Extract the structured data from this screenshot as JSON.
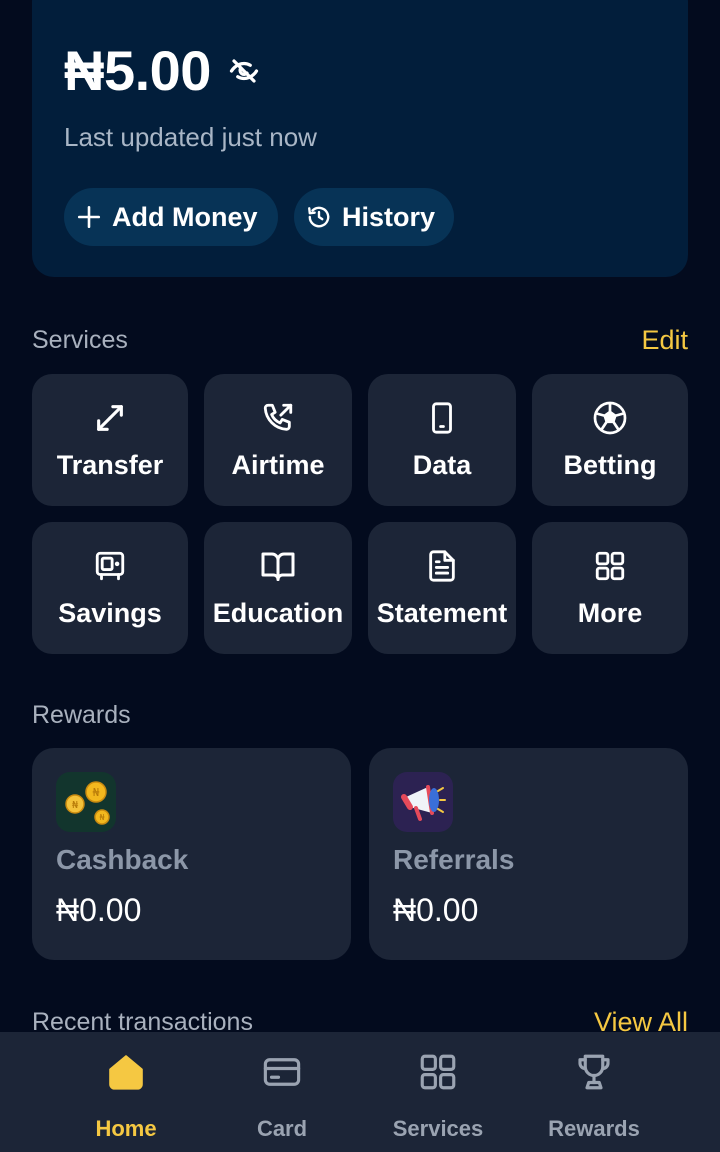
{
  "balance": {
    "amount": "₦5.00",
    "last_updated": "Last updated just now",
    "add_money_label": "Add Money",
    "history_label": "History"
  },
  "services": {
    "title": "Services",
    "edit_label": "Edit",
    "items": [
      {
        "label": "Transfer",
        "icon": "transfer-icon"
      },
      {
        "label": "Airtime",
        "icon": "phone-call-icon"
      },
      {
        "label": "Data",
        "icon": "smartphone-icon"
      },
      {
        "label": "Betting",
        "icon": "soccer-ball-icon"
      },
      {
        "label": "Savings",
        "icon": "safe-icon"
      },
      {
        "label": "Education",
        "icon": "book-icon"
      },
      {
        "label": "Statement",
        "icon": "document-icon"
      },
      {
        "label": "More",
        "icon": "grid-icon"
      }
    ]
  },
  "rewards": {
    "title": "Rewards",
    "cashback": {
      "label": "Cashback",
      "value": "₦0.00",
      "icon": "coins-icon"
    },
    "referrals": {
      "label": "Referrals",
      "value": "₦0.00",
      "icon": "megaphone-icon"
    }
  },
  "recent": {
    "title": "Recent transactions",
    "view_all_label": "View All"
  },
  "nav": {
    "items": [
      {
        "label": "Home",
        "icon": "home-icon",
        "active": true
      },
      {
        "label": "Card",
        "icon": "card-icon",
        "active": false
      },
      {
        "label": "Services",
        "icon": "grid-icon",
        "active": false
      },
      {
        "label": "Rewards",
        "icon": "trophy-icon",
        "active": false
      }
    ]
  },
  "colors": {
    "background": "#030b1e",
    "card": "#021e3b",
    "tile": "#1c2537",
    "accent": "#f5c842",
    "pill": "#073356"
  }
}
